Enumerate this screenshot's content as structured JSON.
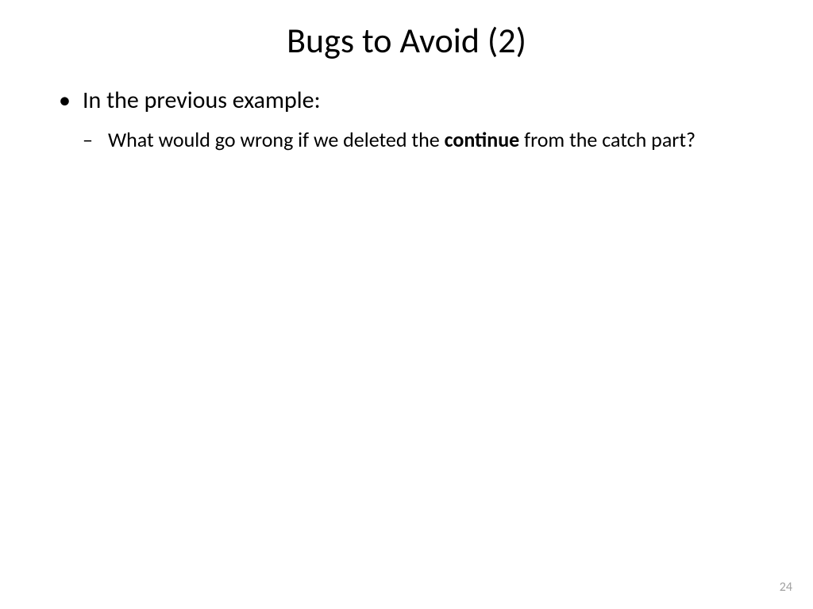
{
  "title": "Bugs to Avoid (2)",
  "bullets": {
    "item1": "In the previous example:",
    "sub1_prefix": "What would go wrong if we deleted the ",
    "sub1_bold": "continue",
    "sub1_suffix": " from the catch part?"
  },
  "pageNumber": "24"
}
